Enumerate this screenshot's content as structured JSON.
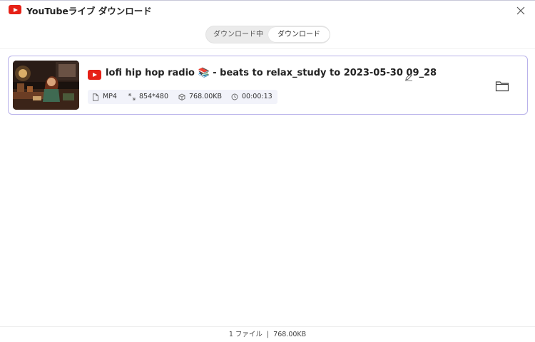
{
  "window": {
    "title": "YouTubeライブ ダウンロード",
    "logo_icon": "youtube-logo-icon",
    "close_icon": "close-icon"
  },
  "tabs": [
    {
      "label": "ダウンロード中",
      "active": false
    },
    {
      "label": "ダウンロード",
      "active": true
    }
  ],
  "items": [
    {
      "title": "lofi hip hop radio 📚 - beats to relax_study to 2023-05-30 09_28",
      "source_icon": "youtube-icon",
      "format": "MP4",
      "resolution": "854*480",
      "size": "768.00KB",
      "duration": "00:00:13",
      "actions": {
        "edit_icon": "edit-icon",
        "folder_icon": "folder-icon"
      }
    }
  ],
  "footer": {
    "count": "1 ファイル",
    "separator": "|",
    "total_size": "768.00KB"
  },
  "colors": {
    "accent_border": "#b9b2ea",
    "youtube_red": "#e62117",
    "meta_bg": "#f2f3fa"
  }
}
